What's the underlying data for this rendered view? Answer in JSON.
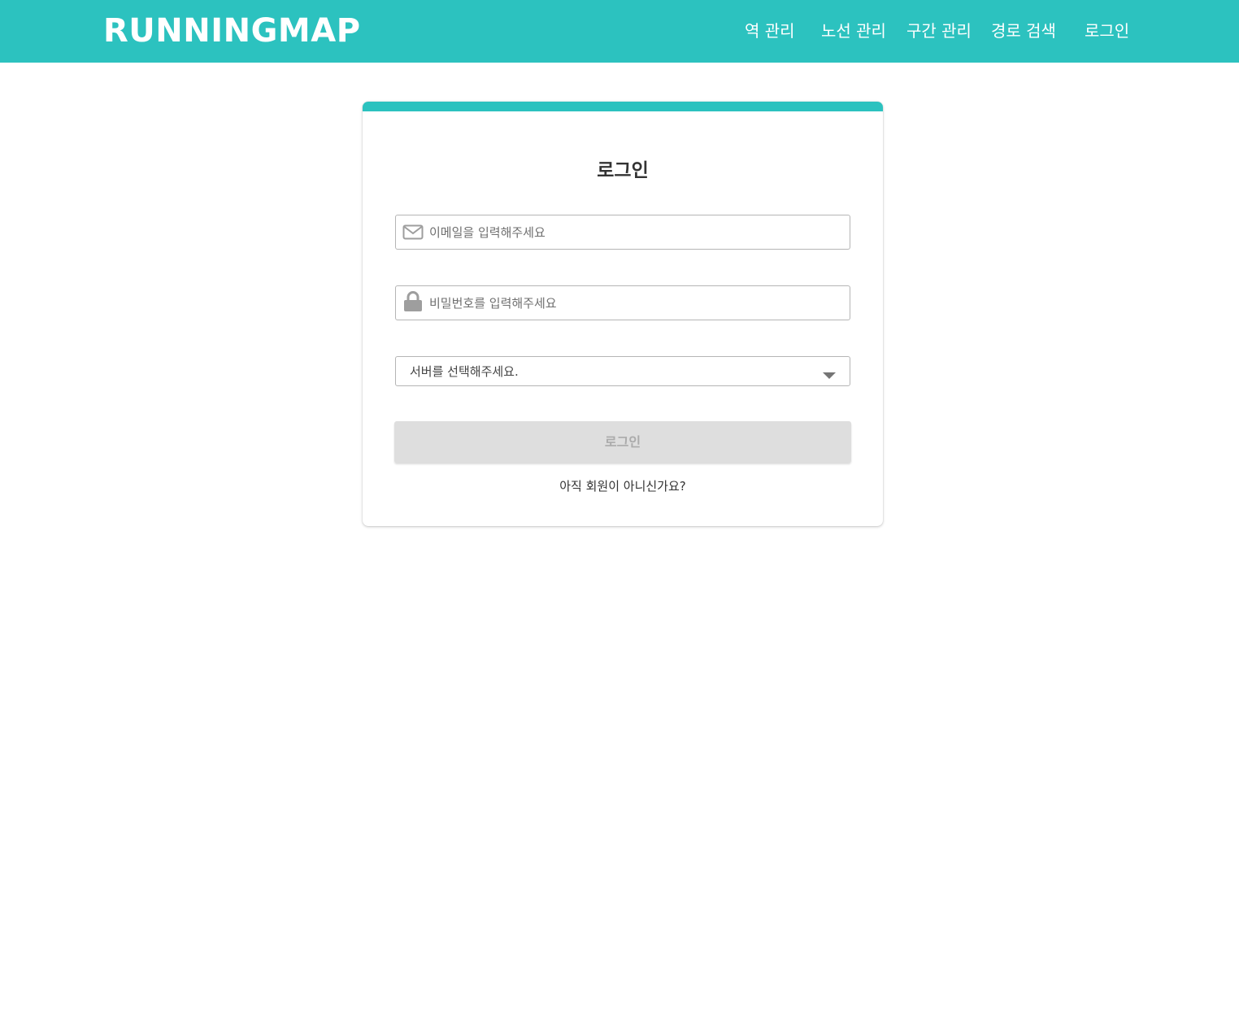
{
  "header": {
    "logo": "RUNNINGMAP",
    "nav": [
      {
        "label": "역 관리"
      },
      {
        "label": "노선 관리"
      },
      {
        "label": "구간 관리"
      },
      {
        "label": "경로 검색"
      },
      {
        "label": "로그인"
      }
    ],
    "accent_color": "#2cc2bf"
  },
  "login_card": {
    "title": "로그인",
    "email": {
      "placeholder": "이메일을 입력해주세요",
      "value": "",
      "icon": "envelope-icon"
    },
    "password": {
      "placeholder": "비밀번호를 입력해주세요",
      "value": "",
      "icon": "lock-icon"
    },
    "server_select": {
      "selected": "서버를 선택해주세요.",
      "icon": "chevron-down-icon"
    },
    "submit_label": "로그인",
    "signup_prompt": "아직 회원이 아니신가요?"
  }
}
